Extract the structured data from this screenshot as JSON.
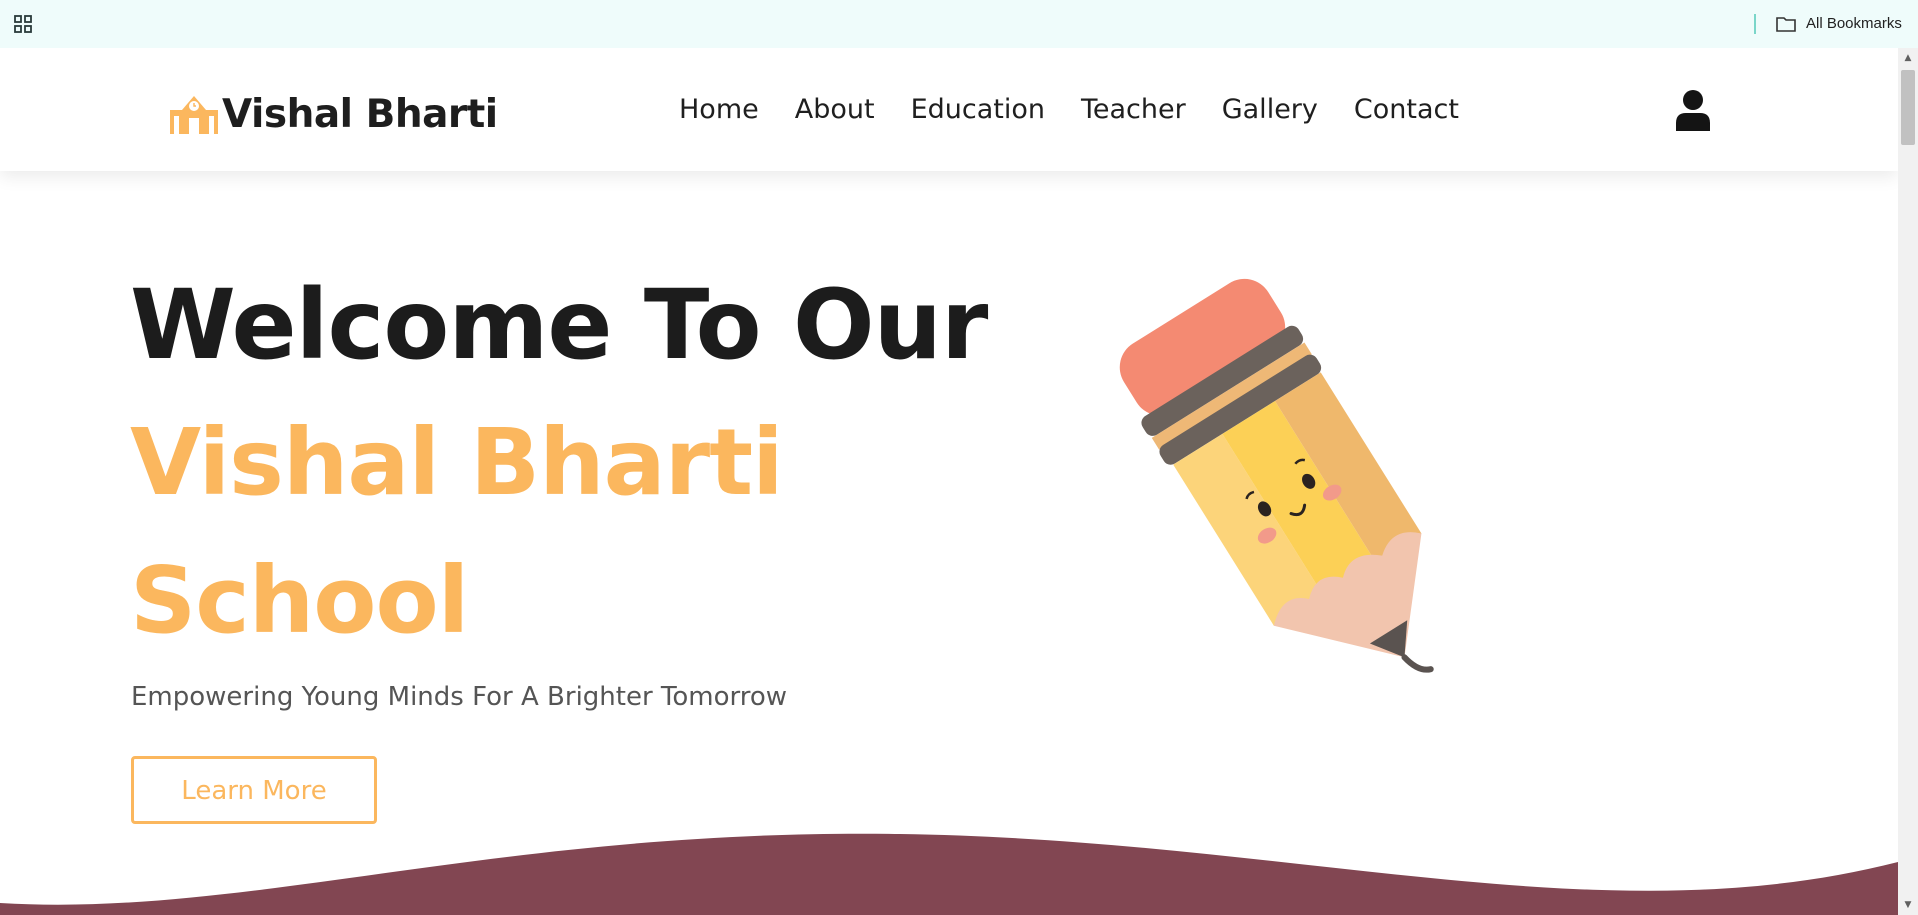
{
  "browser": {
    "bookmarks_label": "All Bookmarks",
    "apps_icon": "apps-grid-icon",
    "folder_icon": "folder-icon"
  },
  "header": {
    "logo_text": "Vishal Bharti",
    "logo_icon": "school-building-icon",
    "nav": [
      "Home",
      "About",
      "Education",
      "Teacher",
      "Gallery",
      "Contact"
    ],
    "user_icon": "user-icon"
  },
  "hero": {
    "line1": "Welcome To Our",
    "line2": "Vishal Bharti",
    "line3": "School",
    "tagline": "Empowering Young Minds For A Brighter Tomorrow",
    "button_label": "Learn More",
    "illustration": "pencil-mascot-illustration"
  },
  "colors": {
    "accent": "#fbb75e",
    "heading": "#1c1c1c",
    "wave": "#824652",
    "bookmarks_bar": "#effcfb"
  }
}
